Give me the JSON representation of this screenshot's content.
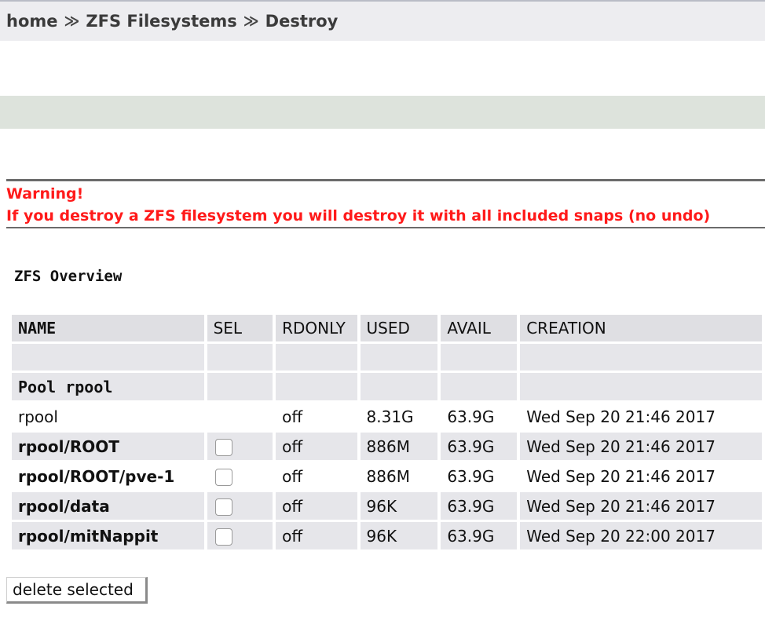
{
  "breadcrumb": {
    "items": [
      "home",
      "ZFS Filesystems",
      "Destroy"
    ],
    "separator": "≫"
  },
  "warning": {
    "title": "Warning!",
    "message": "If you destroy a ZFS filesystem you will destroy it with all included snaps (no undo)",
    "color": "#e8151b"
  },
  "overview": {
    "title": "ZFS Overview",
    "columns": [
      "NAME",
      "SEL",
      "RDONLY",
      "USED",
      "AVAIL",
      "CREATION"
    ],
    "pool_label": "Pool rpool",
    "rows": [
      {
        "name": "rpool",
        "selectable": false,
        "rdonly": "off",
        "used": "8.31G",
        "avail": "63.9G",
        "creation": "Wed Sep 20 21:46 2017"
      },
      {
        "name": "rpool/ROOT",
        "selectable": true,
        "rdonly": "off",
        "used": "886M",
        "avail": "63.9G",
        "creation": "Wed Sep 20 21:46 2017"
      },
      {
        "name": "rpool/ROOT/pve-1",
        "selectable": true,
        "rdonly": "off",
        "used": "886M",
        "avail": "63.9G",
        "creation": "Wed Sep 20 21:46 2017"
      },
      {
        "name": "rpool/data",
        "selectable": true,
        "rdonly": "off",
        "used": "96K",
        "avail": "63.9G",
        "creation": "Wed Sep 20 21:46 2017"
      },
      {
        "name": "rpool/mitNappit",
        "selectable": true,
        "rdonly": "off",
        "used": "96K",
        "avail": "63.9G",
        "creation": "Wed Sep 20 22:00 2017"
      }
    ]
  },
  "actions": {
    "delete_label": "delete selected"
  }
}
